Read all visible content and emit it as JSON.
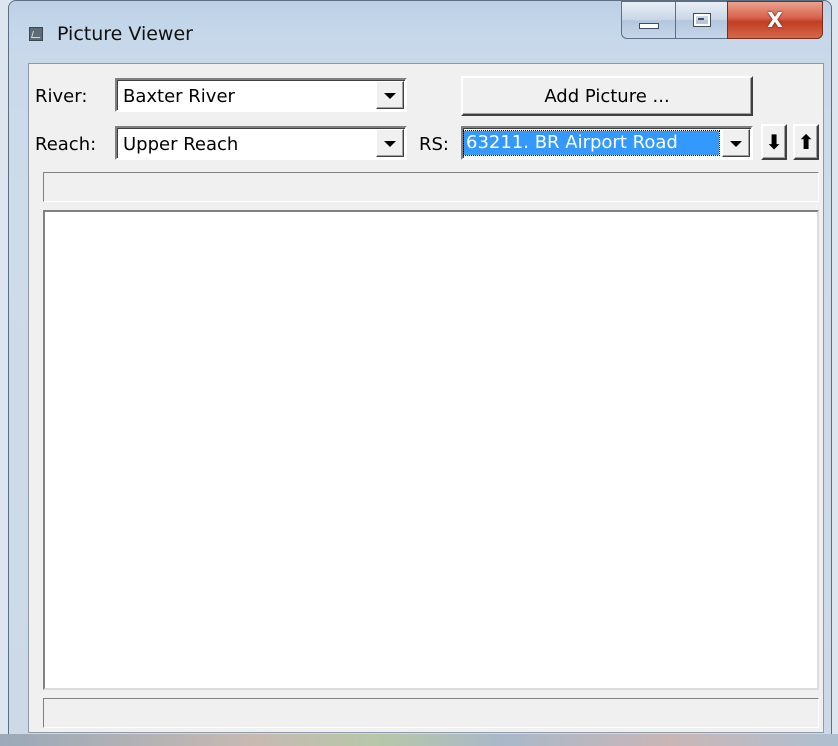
{
  "window": {
    "title": "Picture Viewer",
    "app_icon": "picture-viewer-icon"
  },
  "caption_buttons": {
    "minimize_icon": "minimize-icon",
    "maximize_icon": "maximize-icon",
    "close_glyph": "X"
  },
  "form": {
    "river_label": "River:",
    "river_value": "Baxter River",
    "reach_label": "Reach:",
    "reach_value": "Upper Reach",
    "rs_label": "RS:",
    "rs_value": "63211.  BR  Airport Road",
    "add_picture_label": "Add Picture ...",
    "prev_glyph": "⬇",
    "next_glyph": "⬆"
  },
  "picture_path": "",
  "status_text": "",
  "colors": {
    "selection": "#3399ff",
    "close_button": "#c13e22",
    "face": "#f0f0f0"
  }
}
